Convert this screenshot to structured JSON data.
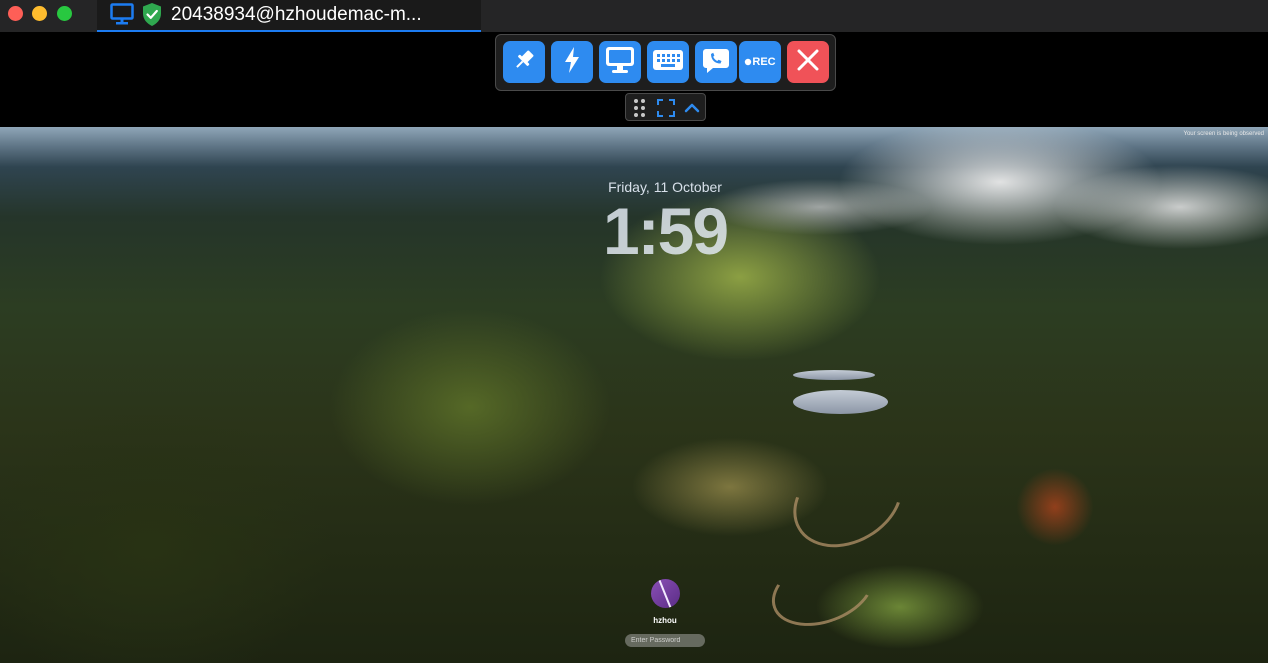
{
  "window": {
    "traffic_lights": [
      "close",
      "minimize",
      "zoom"
    ],
    "tab_title": "20438934@hzhoudemac-m...",
    "tab_icons": [
      "monitor-icon",
      "shield-check-icon"
    ]
  },
  "toolbar": {
    "buttons": [
      {
        "name": "pin",
        "icon": "pin-icon"
      },
      {
        "name": "lightning",
        "icon": "lightning-icon"
      },
      {
        "name": "display",
        "icon": "display-icon"
      },
      {
        "name": "keyboard",
        "icon": "keyboard-icon"
      },
      {
        "name": "chat-call",
        "icon": "chat-phone-icon"
      },
      {
        "name": "record",
        "icon": "record-dot-icon",
        "label": "REC"
      },
      {
        "name": "close",
        "icon": "close-icon"
      }
    ],
    "mini": [
      "drag-handle-icon",
      "fullscreen-icon",
      "chevron-up-icon"
    ]
  },
  "lock_screen": {
    "observed_notice": "Your screen is being observed",
    "date": "Friday, 11 October",
    "time": "1:59",
    "username": "hzhou",
    "password_placeholder": "Enter Password"
  },
  "colors": {
    "accent": "#2e8bf0",
    "close": "#f05258",
    "tab_underline": "#1c7cf2",
    "shield": "#2fa84f"
  }
}
